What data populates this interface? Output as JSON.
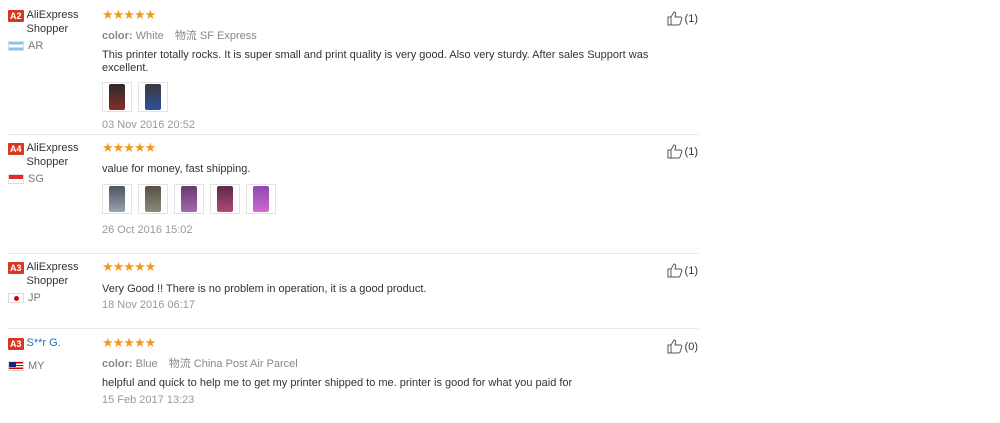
{
  "reviews": [
    {
      "level": "A2",
      "name": "AliExpress Shopper",
      "country": "AR",
      "flag": "flag-ar",
      "stars": "★★★★★",
      "color_label": "color:",
      "color_value": "White",
      "shipping_label": "物流",
      "shipping_value": "SF Express",
      "text": "This printer totally rocks. It is super small and print quality is very good. Also very sturdy. After sales Support was excellent.",
      "photos": [
        {
          "colors": [
            "#2b2b2b",
            "#8a2b2b"
          ]
        },
        {
          "colors": [
            "#3a3a3a",
            "#3050a0"
          ]
        }
      ],
      "date": "03 Nov 2016 20:52",
      "helpful": "(1)"
    },
    {
      "level": "A4",
      "name": "AliExpress Shopper",
      "country": "SG",
      "flag": "flag-sg",
      "stars": "★★★★★",
      "text": "value for money, fast shipping.",
      "photos": [
        {
          "colors": [
            "#4a5560",
            "#9aa4ad"
          ]
        },
        {
          "colors": [
            "#5a5040",
            "#8a8a80"
          ]
        },
        {
          "colors": [
            "#6a3a6a",
            "#a06ab0"
          ]
        },
        {
          "colors": [
            "#5a2a4a",
            "#b04a7a"
          ]
        },
        {
          "colors": [
            "#8a4ab0",
            "#d06ad0"
          ]
        }
      ],
      "date": "26 Oct 2016 15:02",
      "helpful": "(1)"
    },
    {
      "level": "A3",
      "name": "AliExpress Shopper",
      "country": "JP",
      "flag": "flag-jp",
      "stars": "★★★★★",
      "text": "Very Good !! There is no problem in operation, it is a good product.",
      "photos": [],
      "date": "18 Nov 2016 06:17",
      "helpful": "(1)"
    },
    {
      "level": "A3",
      "name": "S**r G.",
      "country": "MY",
      "flag": "flag-my",
      "stars": "★★★★★",
      "color_label": "color:",
      "color_value": "Blue",
      "shipping_label": "物流",
      "shipping_value": "China Post Air Parcel",
      "text": "helpful and quick to help me to get my printer shipped to me. printer is good for what you paid for",
      "photos": [],
      "date": "15 Feb 2017 13:23",
      "helpful": "(0)"
    }
  ],
  "colors": {
    "level_badge": "#d9371f",
    "star": "#f29b1a",
    "link_name": "#2b6db6"
  }
}
